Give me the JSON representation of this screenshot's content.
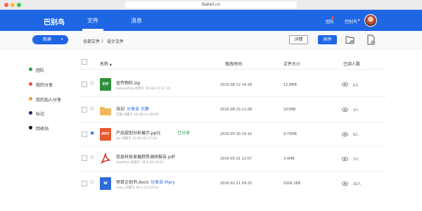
{
  "browser": {
    "url": "Babel.co"
  },
  "header": {
    "logo": "巴别鸟",
    "nav": [
      "文件",
      "消息"
    ],
    "team": "团队",
    "user": "巴别鸟",
    "accent": "#1f66e5"
  },
  "toolbar": {
    "new_label": "新建",
    "breadcrumb": "全部文件 〉 设计文件",
    "detail_label": "详情",
    "sort_label": "排序",
    "icons": [
      "folder-add-icon",
      "file-add-icon"
    ]
  },
  "sidebar": {
    "items": [
      {
        "label": "团队",
        "color": "#2aa14a"
      },
      {
        "label": "我的分享",
        "color": "#e94b3b"
      },
      {
        "label": "我的加入分享",
        "color": "#f0a030"
      },
      {
        "label": "标记",
        "color": "#1a1f6b"
      },
      {
        "label": "回收站",
        "color": "#111111"
      }
    ]
  },
  "table": {
    "headers": {
      "name": "名称 ▴",
      "modified": "修改时间",
      "size": "文件大小",
      "joined": "已阅人数"
    },
    "rows": [
      {
        "icon": "zip",
        "icon_label": "ZIP",
        "icon_color": "#2f8f3a",
        "name": "宣传物料.zip",
        "status": "",
        "meta": "Holywrding 创建于 16-08-12 11:14",
        "modified": "2016-08-12 14:28",
        "size": "12.8MB",
        "readers": "0人",
        "starred": false
      },
      {
        "icon": "folder",
        "icon_label": "",
        "icon_color": "#f0b860",
        "name": "培训",
        "status": "分享自 王静",
        "status_color": "blue",
        "meta": "王静 创建于 16-08-13 08:00",
        "modified": "2016-08-23 11:08",
        "size": "103MB",
        "readers": "3人",
        "starred": false
      },
      {
        "icon": "ppt",
        "icon_label": "PPT",
        "icon_color": "#e65a2e",
        "name": "产品规划分析展示.ppt1",
        "status": "已分享",
        "status_color": "green",
        "meta": "Jay 创建于 16-05-30 17:18",
        "modified": "2016-05-30 10:10",
        "size": "9.75MB",
        "readers": "9人",
        "starred": true
      },
      {
        "icon": "pdf",
        "icon_label": "PDF",
        "icon_color": "#d8302a",
        "name": "信息科技发展趋势调研报告.pdf",
        "status": "",
        "meta": "dowdfee 创建于 16-4-30 14:57",
        "modified": "2016-05-21 12:07",
        "size": "3.4MB",
        "readers": "3人",
        "starred": false
      },
      {
        "icon": "doc",
        "icon_label": "W",
        "icon_color": "#2d6bd8",
        "name": "项目企划书.docx",
        "status": "分享自 Mary",
        "status_color": "blue",
        "meta": "mary 创建于 16-1-31 23:19",
        "modified": "2016-02-11 09:20",
        "size": "1006.2KB",
        "readers": "10人",
        "starred": false
      }
    ]
  }
}
